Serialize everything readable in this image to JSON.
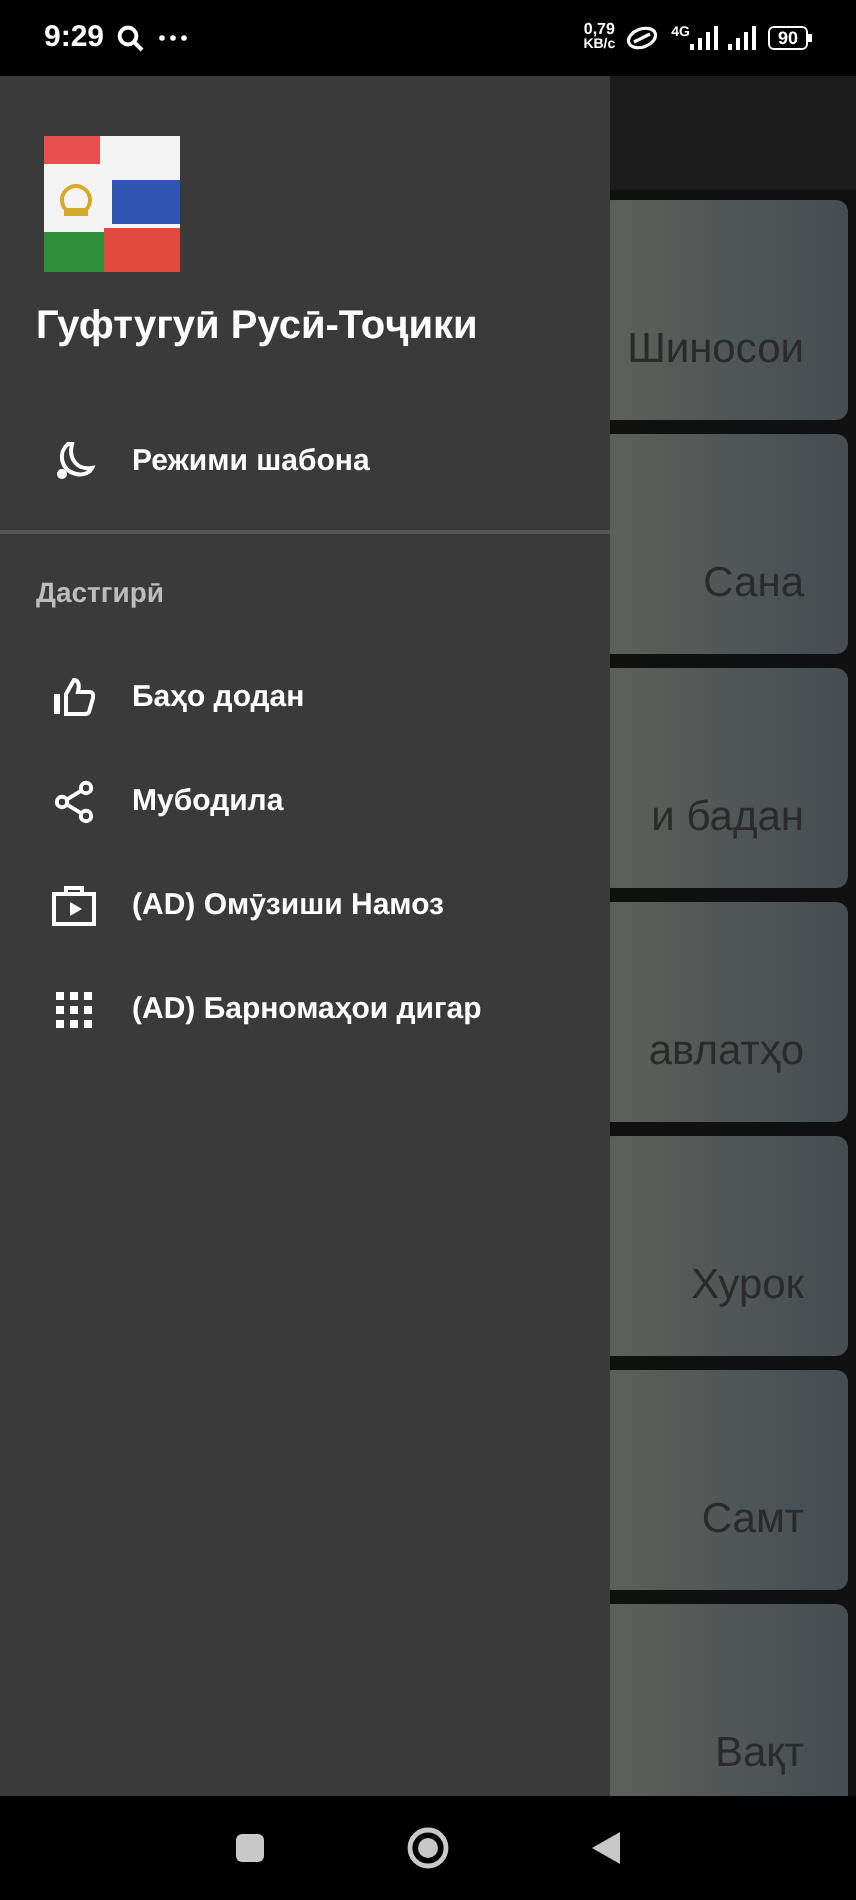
{
  "status_bar": {
    "time": "9:29",
    "speed_value": "0,79",
    "speed_unit": "KB/c",
    "network": "4G",
    "battery": "90"
  },
  "drawer": {
    "app_title": "Гуфтугуӣ Русӣ-Тоҷики",
    "top_items": [
      {
        "kind": "night",
        "label": "Режими шабона"
      }
    ],
    "section_title": "Дастгирӣ",
    "items": [
      {
        "kind": "rate",
        "label": "Баҳо додан"
      },
      {
        "kind": "share",
        "label": "Мубодила"
      },
      {
        "kind": "video",
        "label": "(AD) Омӯзиши Намоз"
      },
      {
        "kind": "apps",
        "label": "(AD) Барномаҳои дигар"
      }
    ]
  },
  "background_cards": [
    "Шиносои",
    "Сана",
    "и бадан",
    "авлатҳо",
    "Хурок",
    "Самт",
    "Вақт"
  ]
}
